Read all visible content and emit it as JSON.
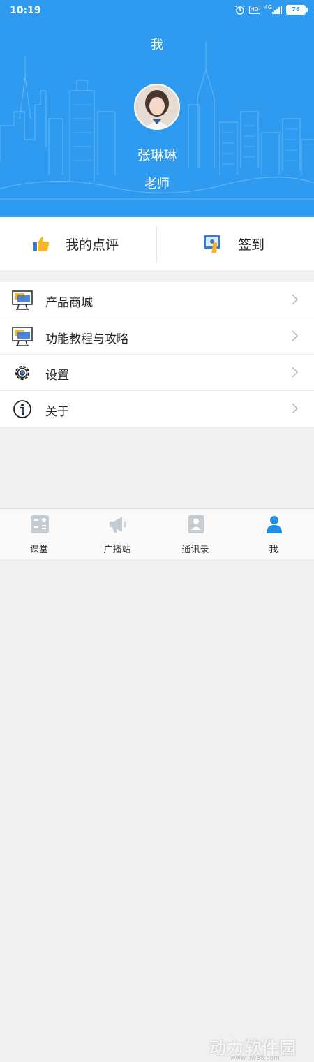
{
  "status": {
    "time": "10:19",
    "hd": "HD",
    "network": "4G",
    "battery": "76"
  },
  "header": {
    "title": "我",
    "name": "张琳琳",
    "role": "老师"
  },
  "actions": [
    {
      "label": "我的点评",
      "icon": "thumbs-up-icon"
    },
    {
      "label": "签到",
      "icon": "checkin-icon"
    }
  ],
  "menu": [
    {
      "label": "产品商城",
      "icon": "monitor-icon"
    },
    {
      "label": "功能教程与攻略",
      "icon": "monitor-icon"
    },
    {
      "label": "设置",
      "icon": "gear-icon"
    },
    {
      "label": "关于",
      "icon": "info-icon"
    }
  ],
  "tabs": [
    {
      "label": "课堂",
      "icon": "calculator-icon"
    },
    {
      "label": "广播站",
      "icon": "megaphone-icon"
    },
    {
      "label": "通讯录",
      "icon": "contacts-icon"
    },
    {
      "label": "我",
      "icon": "person-icon"
    }
  ],
  "watermark": {
    "text": "动力软件园",
    "sub": "www.pw88.com"
  },
  "colors": {
    "header": "#2e9bf0",
    "active_tab": "#1f8fe8",
    "inactive_tab": "#c5cdd3"
  }
}
